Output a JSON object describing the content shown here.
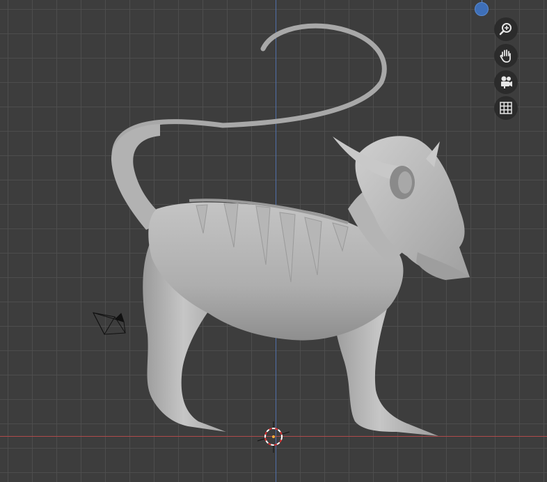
{
  "viewport": {
    "background": "#3d3d3d",
    "grid_color": "#505050",
    "axis_x_color": "#b04a4a",
    "axis_y_color": "#4f6fa8"
  },
  "navigation": {
    "buttons": [
      {
        "name": "zoom",
        "icon": "zoom-magnifier-icon"
      },
      {
        "name": "pan",
        "icon": "hand-icon"
      },
      {
        "name": "camera-view",
        "icon": "camera-icon"
      },
      {
        "name": "toggle-projection",
        "icon": "grid-icon"
      }
    ],
    "gizmo_z_color": "#3e6fb8"
  },
  "scene": {
    "model": "creature-mesh",
    "model_color": "#b8b8b8",
    "camera_object": "camera-icon",
    "cursor_3d": "3d-cursor-icon"
  }
}
